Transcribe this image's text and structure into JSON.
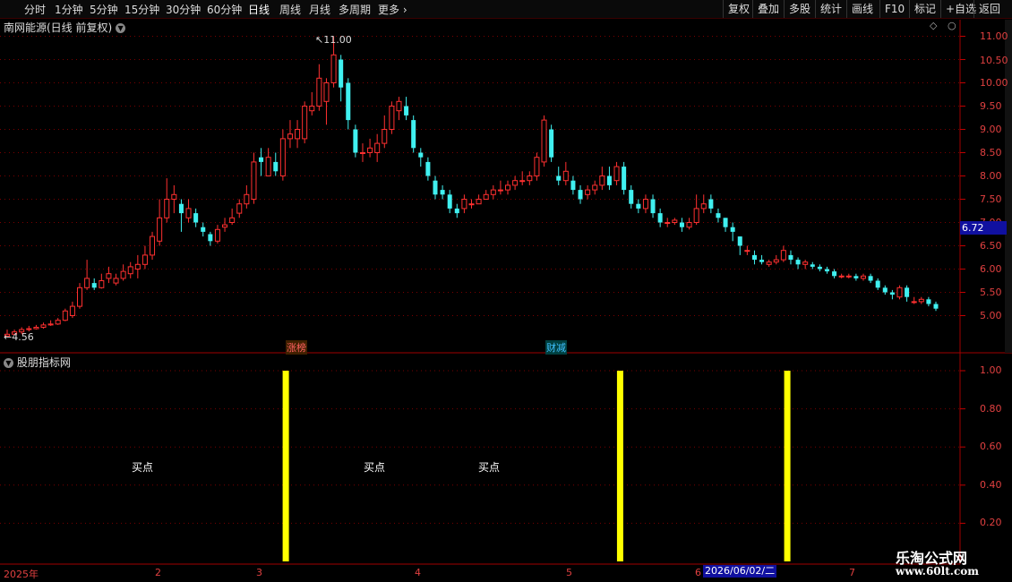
{
  "toolbar": {
    "periods": [
      "分时",
      "1分钟",
      "5分钟",
      "15分钟",
      "30分钟",
      "60分钟",
      "日线",
      "周线",
      "月线",
      "多周期",
      "更多"
    ],
    "active_period": "日线",
    "right_buttons": [
      "复权",
      "叠加",
      "多股",
      "统计",
      "画线",
      "F10",
      "标记",
      "+自选",
      "返回"
    ]
  },
  "main_chart": {
    "title": "南网能源(日线 前复权)",
    "current_price": "6.72",
    "high_label": "11.00",
    "low_label": "4.56",
    "price_axis": [
      "11.00",
      "10.50",
      "10.00",
      "9.50",
      "9.00",
      "8.50",
      "8.00",
      "7.50",
      "7.00",
      "6.50",
      "6.00",
      "5.50",
      "5.00"
    ],
    "event_tags": [
      {
        "text": "涨榜",
        "color": "#ff6060"
      },
      {
        "text": "财减",
        "color": "#40c0ff"
      }
    ]
  },
  "indicator": {
    "title": "股朋指标网",
    "axis": [
      "1.00",
      "0.80",
      "0.60",
      "0.40",
      "0.20"
    ],
    "signal_label": "买点"
  },
  "x_axis": {
    "labels": [
      "2025年",
      "2",
      "3",
      "4",
      "5",
      "6",
      "7"
    ],
    "cursor_date": "2026/06/02/二"
  },
  "watermark": {
    "line1": "乐淘公式网",
    "line2": "www.60lt.com"
  },
  "colors": {
    "up": "#ff3030",
    "down": "#40f0f0",
    "signal": "#ffff00",
    "grid": "#7a0000"
  },
  "chart_data": {
    "type": "candlestick",
    "ylim": [
      4.5,
      11.2
    ],
    "candles": [
      [
        4.56,
        4.6,
        4.7,
        4.55
      ],
      [
        4.6,
        4.65,
        4.7,
        4.58
      ],
      [
        4.65,
        4.7,
        4.75,
        4.6
      ],
      [
        4.7,
        4.72,
        4.78,
        4.66
      ],
      [
        4.72,
        4.75,
        4.8,
        4.7
      ],
      [
        4.75,
        4.8,
        4.85,
        4.72
      ],
      [
        4.8,
        4.82,
        4.9,
        4.78
      ],
      [
        4.82,
        4.9,
        4.95,
        4.8
      ],
      [
        4.9,
        5.1,
        5.15,
        4.88
      ],
      [
        5.0,
        5.2,
        5.3,
        4.95
      ],
      [
        5.2,
        5.6,
        5.7,
        5.15
      ],
      [
        5.6,
        5.8,
        6.2,
        5.55
      ],
      [
        5.7,
        5.6,
        5.8,
        5.55
      ],
      [
        5.6,
        5.75,
        5.9,
        5.58
      ],
      [
        5.8,
        5.9,
        6.05,
        5.7
      ],
      [
        5.7,
        5.8,
        5.9,
        5.65
      ],
      [
        5.8,
        5.95,
        6.1,
        5.75
      ],
      [
        5.9,
        6.05,
        6.15,
        5.8
      ],
      [
        6.0,
        6.1,
        6.3,
        5.8
      ],
      [
        6.1,
        6.3,
        6.5,
        6.0
      ],
      [
        6.3,
        6.7,
        6.8,
        6.2
      ],
      [
        6.6,
        7.1,
        7.5,
        6.5
      ],
      [
        7.1,
        7.5,
        7.95,
        7.0
      ],
      [
        7.5,
        7.6,
        7.8,
        7.2
      ],
      [
        7.4,
        7.2,
        7.5,
        6.8
      ],
      [
        7.1,
        7.3,
        7.5,
        7.0
      ],
      [
        7.2,
        7.0,
        7.3,
        6.9
      ],
      [
        6.9,
        6.8,
        7.0,
        6.7
      ],
      [
        6.75,
        6.6,
        6.8,
        6.5
      ],
      [
        6.6,
        6.85,
        6.95,
        6.55
      ],
      [
        6.9,
        6.95,
        7.1,
        6.8
      ],
      [
        7.0,
        7.1,
        7.3,
        6.95
      ],
      [
        7.2,
        7.4,
        7.5,
        7.1
      ],
      [
        7.4,
        7.6,
        7.8,
        7.3
      ],
      [
        7.5,
        8.3,
        8.5,
        7.4
      ],
      [
        8.4,
        8.3,
        8.6,
        8.0
      ],
      [
        8.0,
        8.4,
        8.6,
        8.0
      ],
      [
        8.3,
        8.1,
        8.5,
        8.0
      ],
      [
        8.0,
        8.8,
        9.0,
        7.9
      ],
      [
        8.8,
        8.9,
        9.2,
        8.6
      ],
      [
        8.8,
        9.0,
        9.2,
        8.6
      ],
      [
        8.8,
        9.5,
        9.6,
        8.7
      ],
      [
        9.4,
        9.5,
        9.8,
        9.3
      ],
      [
        9.5,
        10.1,
        10.4,
        9.4
      ],
      [
        9.6,
        10.0,
        10.1,
        9.1
      ],
      [
        10.0,
        10.6,
        11.0,
        9.9
      ],
      [
        10.5,
        9.9,
        10.6,
        9.6
      ],
      [
        10.0,
        9.2,
        10.1,
        9.0
      ],
      [
        9.0,
        8.5,
        9.1,
        8.4
      ],
      [
        8.5,
        8.5,
        8.7,
        8.3
      ],
      [
        8.5,
        8.6,
        8.8,
        8.4
      ],
      [
        8.5,
        8.7,
        8.9,
        8.3
      ],
      [
        8.7,
        9.0,
        9.3,
        8.6
      ],
      [
        9.0,
        9.5,
        9.6,
        8.9
      ],
      [
        9.4,
        9.6,
        9.7,
        9.2
      ],
      [
        9.5,
        9.3,
        9.7,
        9.2
      ],
      [
        9.2,
        8.6,
        9.3,
        8.5
      ],
      [
        8.5,
        8.4,
        8.6,
        8.2
      ],
      [
        8.3,
        8.0,
        8.4,
        7.9
      ],
      [
        7.9,
        7.6,
        8.0,
        7.5
      ],
      [
        7.7,
        7.6,
        7.8,
        7.5
      ],
      [
        7.6,
        7.3,
        7.7,
        7.2
      ],
      [
        7.3,
        7.2,
        7.4,
        7.1
      ],
      [
        7.3,
        7.5,
        7.6,
        7.2
      ],
      [
        7.4,
        7.4,
        7.5,
        7.3
      ],
      [
        7.4,
        7.5,
        7.6,
        7.4
      ],
      [
        7.5,
        7.6,
        7.7,
        7.5
      ],
      [
        7.6,
        7.7,
        7.8,
        7.5
      ],
      [
        7.7,
        7.7,
        7.9,
        7.6
      ],
      [
        7.7,
        7.8,
        7.9,
        7.6
      ],
      [
        7.8,
        7.9,
        8.0,
        7.7
      ],
      [
        7.9,
        7.9,
        8.1,
        7.8
      ],
      [
        7.9,
        8.0,
        8.1,
        7.8
      ],
      [
        8.0,
        8.4,
        8.5,
        7.9
      ],
      [
        8.3,
        9.2,
        9.3,
        8.2
      ],
      [
        9.0,
        8.4,
        9.1,
        8.3
      ],
      [
        8.0,
        7.9,
        8.2,
        7.8
      ],
      [
        7.9,
        8.1,
        8.3,
        7.8
      ],
      [
        7.9,
        7.7,
        8.0,
        7.6
      ],
      [
        7.7,
        7.5,
        7.8,
        7.4
      ],
      [
        7.6,
        7.7,
        7.8,
        7.5
      ],
      [
        7.7,
        7.8,
        7.9,
        7.6
      ],
      [
        7.8,
        8.0,
        8.2,
        7.7
      ],
      [
        8.0,
        7.8,
        8.2,
        7.7
      ],
      [
        7.9,
        8.2,
        8.3,
        7.8
      ],
      [
        8.2,
        7.7,
        8.3,
        7.6
      ],
      [
        7.7,
        7.4,
        7.8,
        7.3
      ],
      [
        7.4,
        7.3,
        7.5,
        7.2
      ],
      [
        7.3,
        7.5,
        7.6,
        7.2
      ],
      [
        7.5,
        7.2,
        7.6,
        7.1
      ],
      [
        7.2,
        7.0,
        7.3,
        6.9
      ],
      [
        7.0,
        7.0,
        7.1,
        6.9
      ],
      [
        7.0,
        7.05,
        7.1,
        6.95
      ],
      [
        7.0,
        6.9,
        7.1,
        6.8
      ],
      [
        6.9,
        7.0,
        7.1,
        6.85
      ],
      [
        7.0,
        7.3,
        7.6,
        6.95
      ],
      [
        7.3,
        7.4,
        7.6,
        7.2
      ],
      [
        7.5,
        7.3,
        7.6,
        7.2
      ],
      [
        7.2,
        7.1,
        7.3,
        7.0
      ],
      [
        7.1,
        6.9,
        7.1,
        6.8
      ],
      [
        6.9,
        6.8,
        7.0,
        6.6
      ],
      [
        6.7,
        6.5,
        6.7,
        6.3
      ],
      [
        6.4,
        6.4,
        6.5,
        6.3
      ],
      [
        6.3,
        6.2,
        6.4,
        6.1
      ],
      [
        6.2,
        6.15,
        6.3,
        6.1
      ],
      [
        6.1,
        6.15,
        6.2,
        6.05
      ],
      [
        6.15,
        6.2,
        6.3,
        6.1
      ],
      [
        6.2,
        6.4,
        6.5,
        6.15
      ],
      [
        6.3,
        6.2,
        6.4,
        6.1
      ],
      [
        6.2,
        6.1,
        6.25,
        6.0
      ],
      [
        6.1,
        6.15,
        6.2,
        6.0
      ],
      [
        6.1,
        6.05,
        6.15,
        6.0
      ],
      [
        6.05,
        6.0,
        6.1,
        5.95
      ],
      [
        6.0,
        5.95,
        6.05,
        5.9
      ],
      [
        5.95,
        5.85,
        6.0,
        5.8
      ],
      [
        5.85,
        5.85,
        5.9,
        5.8
      ],
      [
        5.85,
        5.85,
        5.9,
        5.8
      ],
      [
        5.85,
        5.8,
        5.9,
        5.75
      ],
      [
        5.8,
        5.85,
        5.9,
        5.75
      ],
      [
        5.85,
        5.75,
        5.9,
        5.7
      ],
      [
        5.75,
        5.6,
        5.8,
        5.55
      ],
      [
        5.6,
        5.5,
        5.65,
        5.45
      ],
      [
        5.5,
        5.45,
        5.55,
        5.35
      ],
      [
        5.4,
        5.6,
        5.65,
        5.35
      ],
      [
        5.6,
        5.4,
        5.65,
        5.3
      ],
      [
        5.3,
        5.3,
        5.4,
        5.25
      ],
      [
        5.3,
        5.35,
        5.4,
        5.25
      ],
      [
        5.35,
        5.25,
        5.4,
        5.2
      ],
      [
        5.25,
        5.15,
        5.3,
        5.1
      ]
    ],
    "signals": [
      0.3,
      0.66,
      0.84
    ]
  }
}
